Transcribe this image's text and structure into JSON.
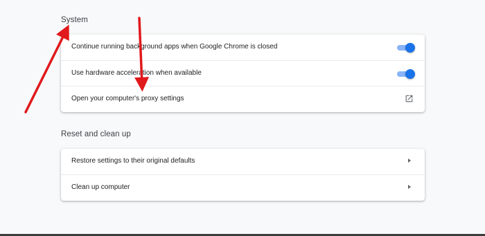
{
  "system": {
    "title": "System",
    "rows": [
      {
        "label": "Continue running background apps when Google Chrome is closed",
        "control": "toggle",
        "checked": true
      },
      {
        "label": "Use hardware acceleration when available",
        "control": "toggle",
        "checked": true
      },
      {
        "label": "Open your computer's proxy settings",
        "control": "open-in-new-icon"
      }
    ]
  },
  "reset": {
    "title": "Reset and clean up",
    "rows": [
      {
        "label": "Restore settings to their original defaults",
        "control": "arrow-right-icon"
      },
      {
        "label": "Clean up computer",
        "control": "arrow-right-icon"
      }
    ]
  },
  "colors": {
    "toggle_on": "#1a73e8",
    "toggle_track": "#8ab4f8",
    "annotation_arrow": "#e0191c",
    "background": "#f8f9fa"
  }
}
